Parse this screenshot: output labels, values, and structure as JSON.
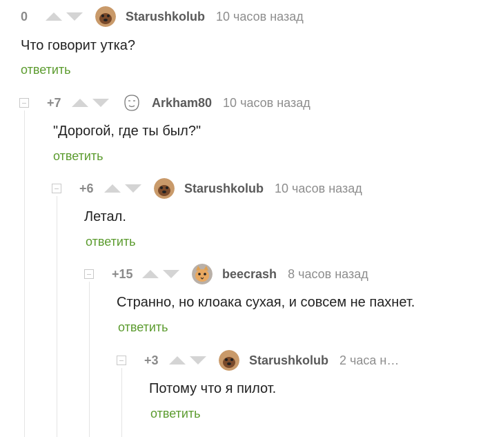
{
  "reply_label": "ответить",
  "colors": {
    "reply": "#5b9b2e",
    "author": "#5a5a5a",
    "time": "#8d8d8d",
    "arrows": "#d4d4d4"
  },
  "comments": [
    {
      "rating": "0",
      "author": "Starushkolub",
      "time": "10 часов назад",
      "text": "Что говорит утка?",
      "avatar": "dog-avatar"
    },
    {
      "rating": "+7",
      "author": "Arkham80",
      "time": "10 часов назад",
      "text": "\"Дорогой, где ты был?\"",
      "avatar": "face-doodle-avatar"
    },
    {
      "rating": "+6",
      "author": "Starushkolub",
      "time": "10 часов назад",
      "text": "Летал.",
      "avatar": "dog-avatar"
    },
    {
      "rating": "+15",
      "author": "beecrash",
      "time": "8 часов назад",
      "text": "Странно, но клоака сухая, и совсем не пахнет.",
      "avatar": "cat-avatar"
    },
    {
      "rating": "+3",
      "author": "Starushkolub",
      "time": "2 часа н…",
      "text": "Потому что я пилот.",
      "avatar": "dog-avatar"
    }
  ]
}
